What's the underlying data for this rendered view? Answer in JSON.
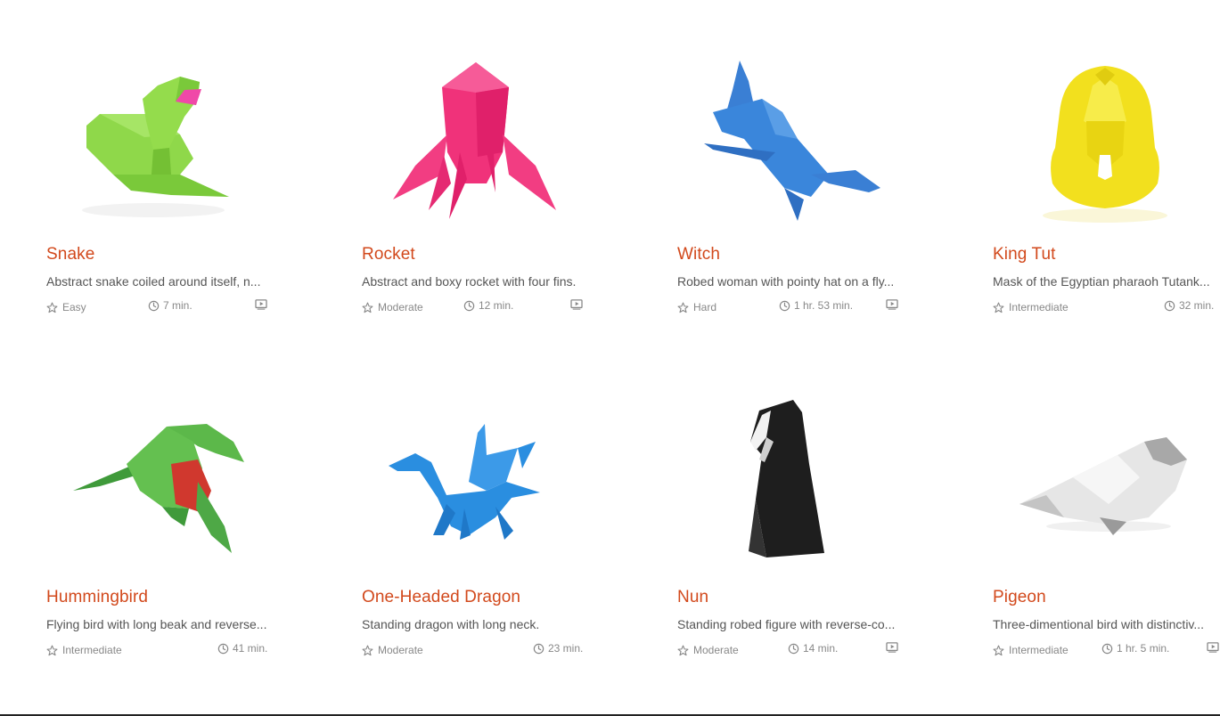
{
  "cards": [
    {
      "title": "Snake",
      "description": "Abstract snake coiled around itself, n...",
      "difficulty": "Easy",
      "time": "7 min.",
      "has_video": true,
      "color": "#8fd84a"
    },
    {
      "title": "Rocket",
      "description": "Abstract and boxy rocket with four fins.",
      "difficulty": "Moderate",
      "time": "12 min.",
      "has_video": true,
      "color": "#f0327a"
    },
    {
      "title": "Witch",
      "description": "Robed woman with pointy hat on a fly...",
      "difficulty": "Hard",
      "time": "1 hr. 53 min.",
      "has_video": true,
      "color": "#3a7fd4"
    },
    {
      "title": "King Tut",
      "description": "Mask of the Egyptian pharaoh Tutank...",
      "difficulty": "Intermediate",
      "time": "32 min.",
      "has_video": false,
      "color": "#f2e01e"
    },
    {
      "title": "Hummingbird",
      "description": "Flying bird with long beak and reverse...",
      "difficulty": "Intermediate",
      "time": "41 min.",
      "has_video": false,
      "color": "#5cb84a"
    },
    {
      "title": "One-Headed Dragon",
      "description": "Standing dragon with long neck.",
      "difficulty": "Moderate",
      "time": "23 min.",
      "has_video": false,
      "color": "#2a8ee0"
    },
    {
      "title": "Nun",
      "description": "Standing robed figure with reverse-co...",
      "difficulty": "Moderate",
      "time": "14 min.",
      "has_video": true,
      "color": "#1e1e1e"
    },
    {
      "title": "Pigeon",
      "description": "Three-dimentional bird with distinctiv...",
      "difficulty": "Intermediate",
      "time": "1 hr. 5 min.",
      "has_video": true,
      "color": "#c8c8c8"
    }
  ],
  "icons": {
    "difficulty": "star-outline-icon",
    "time": "clock-icon",
    "video": "video-play-icon"
  },
  "colors": {
    "title": "#d2491c",
    "description": "#555555",
    "meta": "#888888"
  }
}
